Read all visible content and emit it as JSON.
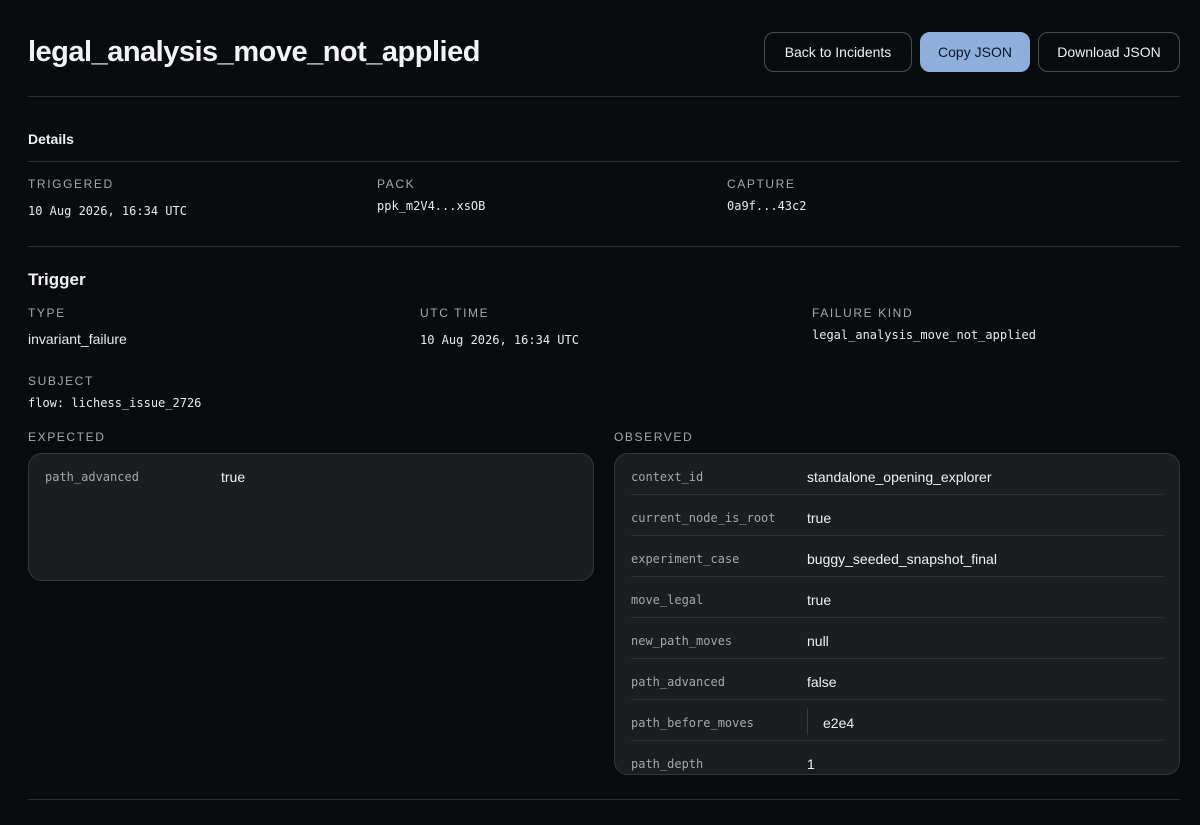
{
  "header": {
    "title": "legal_analysis_move_not_applied",
    "back_label": "Back to Incidents",
    "copy_label": "Copy JSON",
    "download_label": "Download JSON"
  },
  "details": {
    "heading": "Details",
    "triggered_label": "TRIGGERED",
    "triggered_value": "10 Aug 2026, 16:34 UTC",
    "pack_label": "PACK",
    "pack_value": "ppk_m2V4...xsOB",
    "capture_label": "CAPTURE",
    "capture_value": "0a9f...43c2"
  },
  "trigger": {
    "heading": "Trigger",
    "type_label": "TYPE",
    "type_value": "invariant_failure",
    "utc_label": "UTC TIME",
    "utc_value": "10 Aug 2026, 16:34 UTC",
    "kind_label": "FAILURE KIND",
    "kind_value": "legal_analysis_move_not_applied",
    "subject_label": "SUBJECT",
    "subject_value": "flow: lichess_issue_2726"
  },
  "expected": {
    "label": "EXPECTED",
    "rows": [
      {
        "key": "path_advanced",
        "value": "true"
      }
    ]
  },
  "observed": {
    "label": "OBSERVED",
    "rows": [
      {
        "key": "context_id",
        "value": "standalone_opening_explorer"
      },
      {
        "key": "current_node_is_root",
        "value": "true"
      },
      {
        "key": "experiment_case",
        "value": "buggy_seeded_snapshot_final"
      },
      {
        "key": "move_legal",
        "value": "true"
      },
      {
        "key": "new_path_moves",
        "value": "null"
      },
      {
        "key": "path_advanced",
        "value": "false"
      },
      {
        "key": "path_before_moves",
        "value": "e2e4"
      },
      {
        "key": "path_depth",
        "value": "1"
      }
    ]
  }
}
